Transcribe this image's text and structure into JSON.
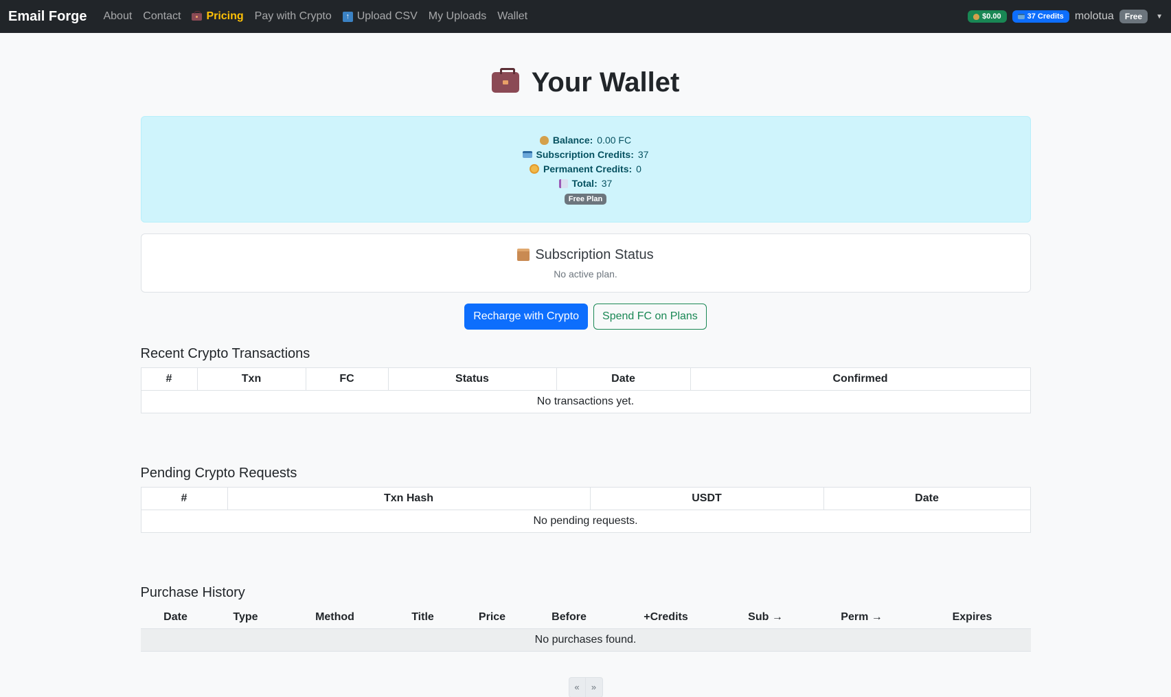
{
  "navbar": {
    "brand": "Email Forge",
    "links": {
      "about": "About",
      "contact": "Contact",
      "pricing": "Pricing",
      "pay_crypto": "Pay with Crypto",
      "upload_csv": "Upload CSV",
      "my_uploads": "My Uploads",
      "wallet": "Wallet"
    },
    "balance_pill": "$0.00",
    "credits_pill": "37 Credits",
    "username": "molotua",
    "plan_pill": "Free"
  },
  "page": {
    "title": "Your Wallet"
  },
  "wallet": {
    "balance_label": "Balance:",
    "balance_value": "0.00 FC",
    "sub_credits_label": "Subscription Credits:",
    "sub_credits_value": "37",
    "perm_credits_label": "Permanent Credits:",
    "perm_credits_value": "0",
    "total_label": "Total:",
    "total_value": "37",
    "plan_badge": "Free Plan"
  },
  "subscription": {
    "title": "Subscription Status",
    "text": "No active plan."
  },
  "buttons": {
    "recharge": "Recharge with Crypto",
    "spend": "Spend FC on Plans"
  },
  "crypto_transactions": {
    "title": "Recent Crypto Transactions",
    "headers": [
      "#",
      "Txn",
      "FC",
      "Status",
      "Date",
      "Confirmed"
    ],
    "empty": "No transactions yet."
  },
  "pending_requests": {
    "title": "Pending Crypto Requests",
    "headers": [
      "#",
      "Txn Hash",
      "USDT",
      "Date"
    ],
    "empty": "No pending requests."
  },
  "purchase_history": {
    "title": "Purchase History",
    "headers": [
      "Date",
      "Type",
      "Method",
      "Title",
      "Price",
      "Before",
      "+Credits",
      "Sub →",
      "Perm →",
      "Expires"
    ],
    "empty": "No purchases found."
  },
  "pagination": {
    "prev": "«",
    "next": "»"
  },
  "colors": {
    "navbar": "#212529",
    "pricing": "#ffc107",
    "success": "#198754",
    "primary": "#0d6efd",
    "info_bg": "#cff4fc"
  }
}
